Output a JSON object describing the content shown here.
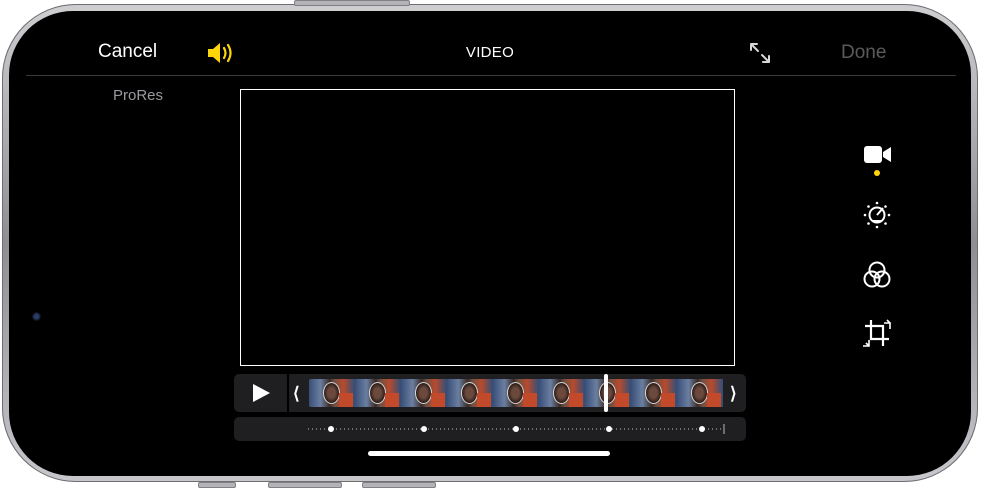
{
  "header": {
    "cancel_label": "Cancel",
    "title": "VIDEO",
    "done_label": "Done"
  },
  "format_badge": "ProRes",
  "icons": {
    "sound": "speaker-on-icon",
    "aspect": "expand-arrows-icon",
    "play": "play-icon"
  },
  "tools": [
    {
      "name": "video",
      "icon": "video-camera-icon",
      "selected": true
    },
    {
      "name": "adjust",
      "icon": "adjust-dial-icon",
      "selected": false
    },
    {
      "name": "filters",
      "icon": "filters-icon",
      "selected": false
    },
    {
      "name": "crop",
      "icon": "crop-icon",
      "selected": false
    }
  ],
  "timeline": {
    "playhead_position": 0.71
  },
  "colors": {
    "accent": "#ffd60a",
    "background": "#000000",
    "done_disabled": "#5b5b5e"
  }
}
